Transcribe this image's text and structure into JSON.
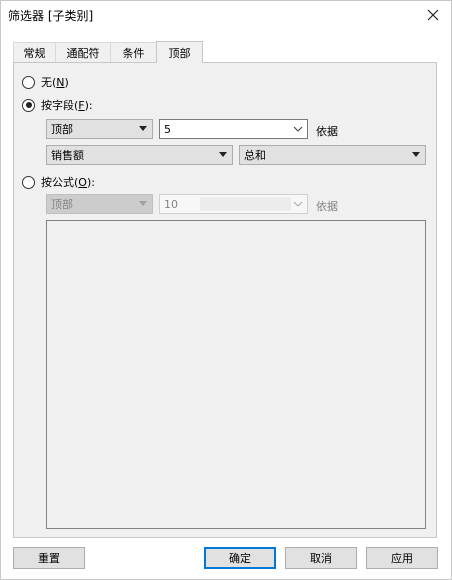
{
  "window": {
    "title": "筛选器 [子类别]"
  },
  "tabs": [
    {
      "label": "常规"
    },
    {
      "label": "通配符"
    },
    {
      "label": "条件"
    },
    {
      "label": "顶部"
    }
  ],
  "options": {
    "none": {
      "label_pre": "无(",
      "key": "N",
      "label_post": ")"
    },
    "by_field": {
      "label_pre": "按字段(",
      "key": "F",
      "label_post": "):"
    },
    "by_formula": {
      "label_pre": "按公式(",
      "key": "O",
      "label_post": "):"
    }
  },
  "field": {
    "direction": "顶部",
    "count": "5",
    "by_label": "依据",
    "measure": "销售额",
    "aggregation": "总和"
  },
  "formula": {
    "direction": "顶部",
    "count": "10",
    "by_label": "依据"
  },
  "buttons": {
    "reset": "重置",
    "ok": "确定",
    "cancel": "取消",
    "apply": "应用"
  }
}
